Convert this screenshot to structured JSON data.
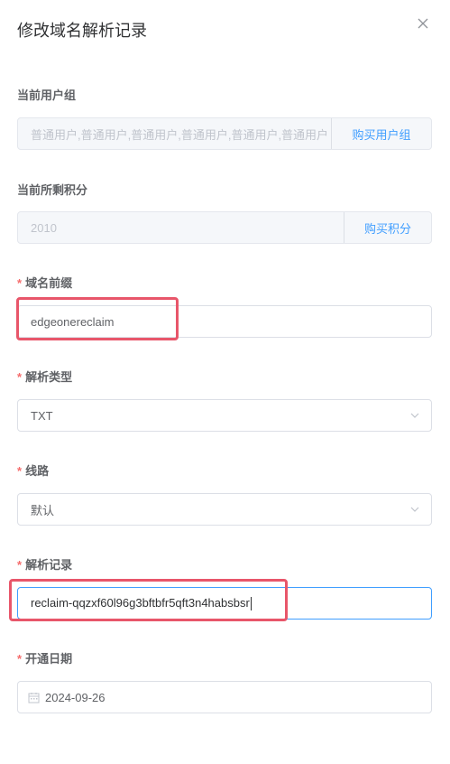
{
  "dialog": {
    "title": "修改域名解析记录"
  },
  "user_group": {
    "label": "当前用户组",
    "value": "普通用户,普通用户,普通用户,普通用户,普通用户,普通用户",
    "button": "购买用户组"
  },
  "points": {
    "label": "当前所剩积分",
    "value": "2010",
    "button": "购买积分"
  },
  "prefix": {
    "required_mark": "*",
    "label": "域名前缀",
    "value": "edgeonereclaim"
  },
  "record_type": {
    "required_mark": "*",
    "label": "解析类型",
    "value": "TXT"
  },
  "line": {
    "required_mark": "*",
    "label": "线路",
    "value": "默认"
  },
  "record": {
    "required_mark": "*",
    "label": "解析记录",
    "value": "reclaim-qqzxf60l96g3bftbfr5qft3n4habsbsr"
  },
  "open_date": {
    "required_mark": "*",
    "label": "开通日期",
    "value": "2024-09-26"
  },
  "colors": {
    "primary": "#409eff",
    "required": "#f56c6c",
    "highlight": "#e8566a"
  }
}
